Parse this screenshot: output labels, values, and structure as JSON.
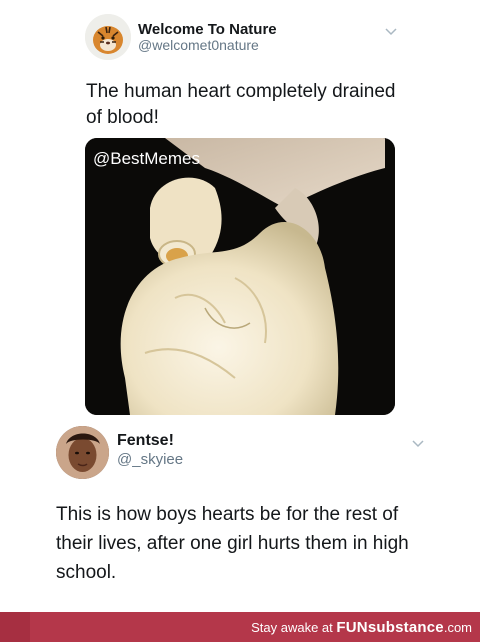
{
  "tweet1": {
    "author_name": "Welcome To Nature",
    "author_handle": "@welcomet0nature",
    "text": "The human heart completely drained of blood!",
    "media_watermark": "@BestMemes",
    "avatar_icon": "tiger-avatar",
    "menu_icon": "chevron-down-icon"
  },
  "tweet2": {
    "author_name": "Fentse!",
    "author_handle": "@_skyiee",
    "text": "This is how boys hearts be for the rest of their lives, after one girl hurts them in high school.",
    "avatar_icon": "person-avatar",
    "menu_icon": "chevron-down-icon"
  },
  "footer": {
    "prefix": "Stay awake at ",
    "brand_a": "FUN",
    "brand_b": "substance",
    "suffix": ".com",
    "background": "#b4374a"
  },
  "colors": {
    "text_primary": "#14171a",
    "text_secondary": "#657786"
  }
}
